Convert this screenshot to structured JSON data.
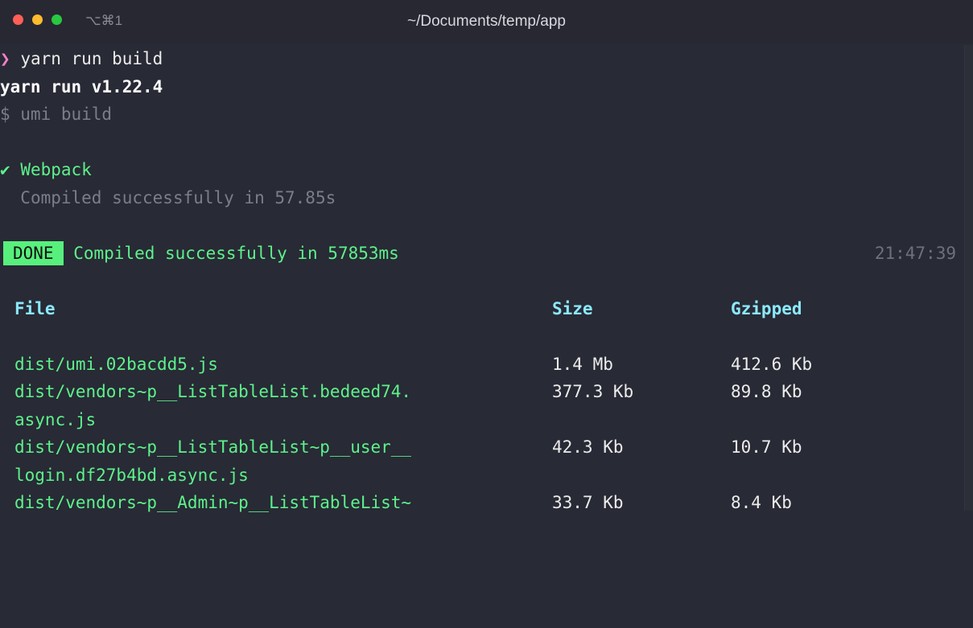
{
  "window": {
    "shortcut": "⌥⌘1",
    "title": "~/Documents/temp/app"
  },
  "terminal": {
    "prompt_symbol": "❯",
    "command": "yarn run build",
    "yarn_version_line": "yarn run v1.22.4",
    "umi_line": "$ umi build",
    "webpack_check": "✔",
    "webpack_label": "Webpack",
    "webpack_compiled": "Compiled successfully in 57.85s",
    "done_badge": "DONE",
    "done_message": "Compiled successfully in 57853ms",
    "done_time": "21:47:39",
    "table": {
      "headers": [
        "File",
        "Size",
        "Gzipped"
      ],
      "rows": [
        {
          "file": "dist/umi.02bacdd5.js",
          "size": "1.4 Mb",
          "gzipped": "412.6 Kb"
        },
        {
          "file": "dist/vendors~p__ListTableList.bedeed74.",
          "size": "377.3 Kb",
          "gzipped": "89.8 Kb"
        },
        {
          "file": "async.js",
          "size": "",
          "gzipped": ""
        },
        {
          "file": "dist/vendors~p__ListTableList~p__user__",
          "size": "42.3 Kb",
          "gzipped": "10.7 Kb"
        },
        {
          "file": "login.df27b4bd.async.js",
          "size": "",
          "gzipped": ""
        },
        {
          "file": "dist/vendors~p__Admin~p__ListTableList~",
          "size": "33.7 Kb",
          "gzipped": "8.4 Kb"
        }
      ]
    }
  },
  "colors": {
    "background": "#282a35",
    "green": "#5df28b",
    "cyan": "#8be9fd",
    "pink": "#f380c8",
    "badge": "#58f07d"
  }
}
